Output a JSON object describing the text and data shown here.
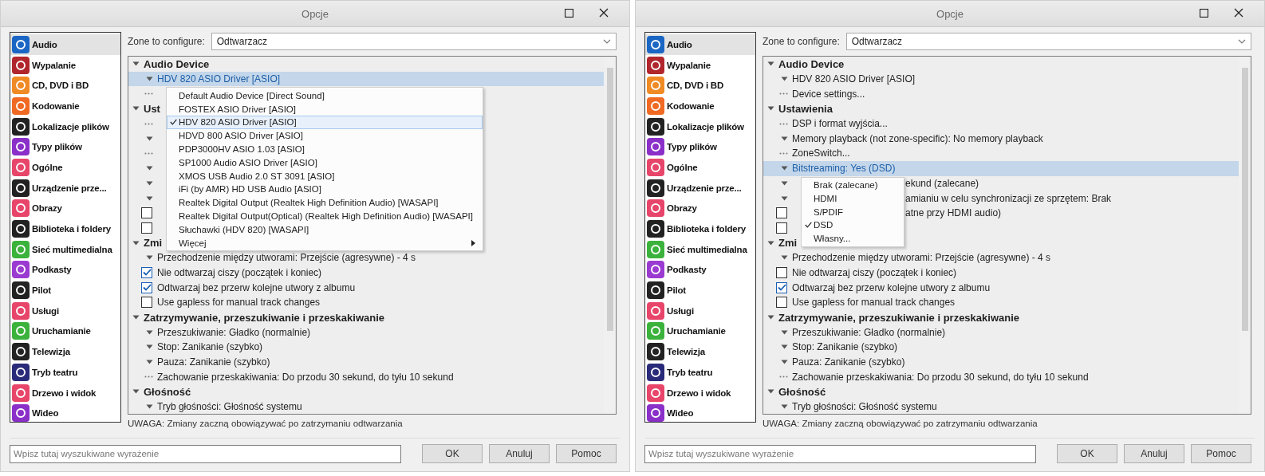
{
  "windows": [
    {
      "title": "Opcje",
      "sidebar": [
        {
          "label": "Audio",
          "color": "#1a66c4",
          "selected": true
        },
        {
          "label": "Wypalanie",
          "color": "#b0262c",
          "selected": false
        },
        {
          "label": "CD, DVD i BD",
          "color": "#f08a24",
          "selected": false
        },
        {
          "label": "Kodowanie",
          "color": "#f06a24",
          "selected": false
        },
        {
          "label": "Lokalizacje plików",
          "color": "#222222",
          "selected": false
        },
        {
          "label": "Typy plików",
          "color": "#8b2fc9",
          "selected": false
        },
        {
          "label": "Ogólne",
          "color": "#e8456a",
          "selected": false
        },
        {
          "label": "Urządzenie prze...",
          "color": "#222222",
          "selected": false
        },
        {
          "label": "Obrazy",
          "color": "#e8456a",
          "selected": false
        },
        {
          "label": "Biblioteka i foldery",
          "color": "#222222",
          "selected": false
        },
        {
          "label": "Sieć multimedialna",
          "color": "#3bb23b",
          "selected": false
        },
        {
          "label": "Podkasty",
          "color": "#9b3ad0",
          "selected": false
        },
        {
          "label": "Pilot",
          "color": "#222222",
          "selected": false
        },
        {
          "label": "Usługi",
          "color": "#e8456a",
          "selected": false
        },
        {
          "label": "Uruchamianie",
          "color": "#3bb23b",
          "selected": false
        },
        {
          "label": "Telewizja",
          "color": "#222222",
          "selected": false
        },
        {
          "label": "Tryb teatru",
          "color": "#2a2a7a",
          "selected": false
        },
        {
          "label": "Drzewo i widok",
          "color": "#e8456a",
          "selected": false
        },
        {
          "label": "Wideo",
          "color": "#8b2fc9",
          "selected": false
        }
      ],
      "zone": {
        "label": "Zone to configure:",
        "value": "Odtwarzacz"
      },
      "tree": [
        {
          "kind": "header",
          "text": "Audio Device",
          "selected": false
        },
        {
          "kind": "arrow",
          "text": "HDV 820 ASIO Driver [ASIO]",
          "selected": true
        },
        {
          "kind": "dots",
          "selected": false
        },
        {
          "kind": "header",
          "text": "Ust",
          "selected": false
        },
        {
          "kind": "dots",
          "selected": false
        },
        {
          "kind": "arrow",
          "selected": false
        },
        {
          "kind": "dots",
          "selected": false
        },
        {
          "kind": "arrow",
          "selected": false
        },
        {
          "kind": "arrow",
          "selected": false
        },
        {
          "kind": "arrow",
          "selected": false
        },
        {
          "kind": "checkbox",
          "checked": false,
          "selected": false
        },
        {
          "kind": "checkbox",
          "checked": false,
          "selected": false
        },
        {
          "kind": "header",
          "text": "Zmi",
          "selected": false
        },
        {
          "kind": "arrow",
          "text": "Przechodzenie między utworami: Przejście (agresywne) - 4 s",
          "selected": false
        },
        {
          "kind": "checkbox",
          "text": "Nie odtwarzaj ciszy (początek i koniec)",
          "checked": true,
          "selected": false
        },
        {
          "kind": "checkbox",
          "text": "Odtwarzaj bez przerw kolejne utwory z albumu",
          "checked": true,
          "selected": false
        },
        {
          "kind": "checkbox",
          "text": "Use gapless for manual track changes",
          "checked": false,
          "selected": false
        },
        {
          "kind": "header",
          "text": "Zatrzymywanie, przeszukiwanie i przeskakiwanie",
          "selected": false
        },
        {
          "kind": "arrow",
          "text": "Przeszukiwanie: Gładko (normalnie)",
          "selected": false
        },
        {
          "kind": "arrow",
          "text": "Stop: Zanikanie (szybko)",
          "selected": false
        },
        {
          "kind": "arrow",
          "text": "Pauza: Zanikanie (szybko)",
          "selected": false
        },
        {
          "kind": "dots",
          "text": "Zachowanie przeskakiwania: Do przodu 30 sekund, do tyłu 10 sekund",
          "selected": false
        },
        {
          "kind": "header",
          "text": "Głośność",
          "selected": false
        },
        {
          "kind": "arrow",
          "text": "Tryb głośności: Głośność systemu",
          "selected": false
        }
      ],
      "dropdown": [
        {
          "text": "Default Audio Device [Direct Sound]",
          "checked": false,
          "hover": false,
          "submenu": false
        },
        {
          "text": "FOSTEX ASIO Driver [ASIO]",
          "checked": false,
          "hover": false,
          "submenu": false
        },
        {
          "text": "HDV 820 ASIO Driver [ASIO]",
          "checked": true,
          "hover": true,
          "submenu": false
        },
        {
          "text": "HDVD 800 ASIO Driver [ASIO]",
          "checked": false,
          "hover": false,
          "submenu": false
        },
        {
          "text": "PDP3000HV ASIO 1.03 [ASIO]",
          "checked": false,
          "hover": false,
          "submenu": false
        },
        {
          "text": "SP1000 Audio ASIO Driver [ASIO]",
          "checked": false,
          "hover": false,
          "submenu": false
        },
        {
          "text": "XMOS USB Audio 2.0 ST 3091 [ASIO]",
          "checked": false,
          "hover": false,
          "submenu": false
        },
        {
          "text": "iFi (by AMR) HD USB Audio [ASIO]",
          "checked": false,
          "hover": false,
          "submenu": false
        },
        {
          "text": "Realtek Digital Output (Realtek High Definition Audio) [WASAPI]",
          "checked": false,
          "hover": false,
          "submenu": false
        },
        {
          "text": "Realtek Digital Output(Optical) (Realtek High Definition Audio) [WASAPI]",
          "checked": false,
          "hover": false,
          "submenu": false
        },
        {
          "text": "Słuchawki (HDV 820) [WASAPI]",
          "checked": false,
          "hover": false,
          "submenu": false
        },
        {
          "text": "Więcej",
          "checked": false,
          "hover": false,
          "submenu": true
        }
      ],
      "note": "UWAGA: Zmiany zaczną obowiązywać po zatrzymaniu odtwarzania",
      "search": {
        "placeholder": "Wpisz tutaj wyszukiwane wyrażenie"
      },
      "buttons": [
        "OK",
        "Anuluj",
        "Pomoc"
      ]
    },
    {
      "title": "Opcje",
      "sidebar": [
        {
          "label": "Audio",
          "color": "#1a66c4",
          "selected": true
        },
        {
          "label": "Wypalanie",
          "color": "#b0262c",
          "selected": false
        },
        {
          "label": "CD, DVD i BD",
          "color": "#f08a24",
          "selected": false
        },
        {
          "label": "Kodowanie",
          "color": "#f06a24",
          "selected": false
        },
        {
          "label": "Lokalizacje plików",
          "color": "#222222",
          "selected": false
        },
        {
          "label": "Typy plików",
          "color": "#8b2fc9",
          "selected": false
        },
        {
          "label": "Ogólne",
          "color": "#e8456a",
          "selected": false
        },
        {
          "label": "Urządzenie prze...",
          "color": "#222222",
          "selected": false
        },
        {
          "label": "Obrazy",
          "color": "#e8456a",
          "selected": false
        },
        {
          "label": "Biblioteka i foldery",
          "color": "#222222",
          "selected": false
        },
        {
          "label": "Sieć multimedialna",
          "color": "#3bb23b",
          "selected": false
        },
        {
          "label": "Podkasty",
          "color": "#9b3ad0",
          "selected": false
        },
        {
          "label": "Pilot",
          "color": "#222222",
          "selected": false
        },
        {
          "label": "Usługi",
          "color": "#e8456a",
          "selected": false
        },
        {
          "label": "Uruchamianie",
          "color": "#3bb23b",
          "selected": false
        },
        {
          "label": "Telewizja",
          "color": "#222222",
          "selected": false
        },
        {
          "label": "Tryb teatru",
          "color": "#2a2a7a",
          "selected": false
        },
        {
          "label": "Drzewo i widok",
          "color": "#e8456a",
          "selected": false
        },
        {
          "label": "Wideo",
          "color": "#8b2fc9",
          "selected": false
        }
      ],
      "zone": {
        "label": "Zone to configure:",
        "value": "Odtwarzacz"
      },
      "tree": [
        {
          "kind": "header",
          "text": "Audio Device",
          "selected": false
        },
        {
          "kind": "arrow",
          "text": "HDV 820 ASIO Driver [ASIO]",
          "selected": false
        },
        {
          "kind": "dots",
          "text": "Device settings...",
          "selected": false
        },
        {
          "kind": "header",
          "text": "Ustawienia",
          "selected": false
        },
        {
          "kind": "dots",
          "text": "DSP i format wyjścia...",
          "selected": false
        },
        {
          "kind": "arrow",
          "text": "Memory playback (not zone-specific): No memory playback",
          "selected": false
        },
        {
          "kind": "dots",
          "text": "ZoneSwitch...",
          "selected": false
        },
        {
          "kind": "arrow",
          "text": "Bitstreaming: Yes (DSD)",
          "selected": true
        },
        {
          "kind": "arrow",
          "tail": "ekund (zalecane)",
          "selected": false
        },
        {
          "kind": "arrow",
          "tail": "amianiu w celu synchronizacji ze sprzętem: Brak",
          "selected": false
        },
        {
          "kind": "checkbox",
          "tail": "atne przy HDMI audio)",
          "checked": false,
          "selected": false
        },
        {
          "kind": "checkbox",
          "checked": false,
          "selected": false
        },
        {
          "kind": "header",
          "text": "Zmi",
          "selected": false
        },
        {
          "kind": "arrow",
          "text": "Przechodzenie między utworami: Przejście (agresywne) - 4 s",
          "selected": false
        },
        {
          "kind": "checkbox",
          "text": "Nie odtwarzaj ciszy (początek i koniec)",
          "checked": false,
          "selected": false
        },
        {
          "kind": "checkbox",
          "text": "Odtwarzaj bez przerw kolejne utwory z albumu",
          "checked": true,
          "selected": false
        },
        {
          "kind": "checkbox",
          "text": "Use gapless for manual track changes",
          "checked": false,
          "selected": false
        },
        {
          "kind": "header",
          "text": "Zatrzymywanie, przeszukiwanie i przeskakiwanie",
          "selected": false
        },
        {
          "kind": "arrow",
          "text": "Przeszukiwanie: Gładko (normalnie)",
          "selected": false
        },
        {
          "kind": "arrow",
          "text": "Stop: Zanikanie (szybko)",
          "selected": false
        },
        {
          "kind": "arrow",
          "text": "Pauza: Zanikanie (szybko)",
          "selected": false
        },
        {
          "kind": "dots",
          "text": "Zachowanie przeskakiwania: Do przodu 30 sekund, do tyłu 10 sekund",
          "selected": false
        },
        {
          "kind": "header",
          "text": "Głośność",
          "selected": false
        },
        {
          "kind": "arrow",
          "text": "Tryb głośności: Głośność systemu",
          "selected": false
        }
      ],
      "dropdown": [
        {
          "text": "Brak (zalecane)",
          "checked": false,
          "hover": false,
          "submenu": false
        },
        {
          "text": "HDMI",
          "checked": false,
          "hover": false,
          "submenu": false
        },
        {
          "text": "S/PDIF",
          "checked": false,
          "hover": false,
          "submenu": false
        },
        {
          "text": "DSD",
          "checked": true,
          "hover": false,
          "submenu": false
        },
        {
          "text": "Własny...",
          "checked": false,
          "hover": false,
          "submenu": false
        }
      ],
      "note": "UWAGA: Zmiany zaczną obowiązywać po zatrzymaniu odtwarzania",
      "search": {
        "placeholder": "Wpisz tutaj wyszukiwane wyrażenie"
      },
      "buttons": [
        "OK",
        "Anuluj",
        "Pomoc"
      ]
    }
  ]
}
